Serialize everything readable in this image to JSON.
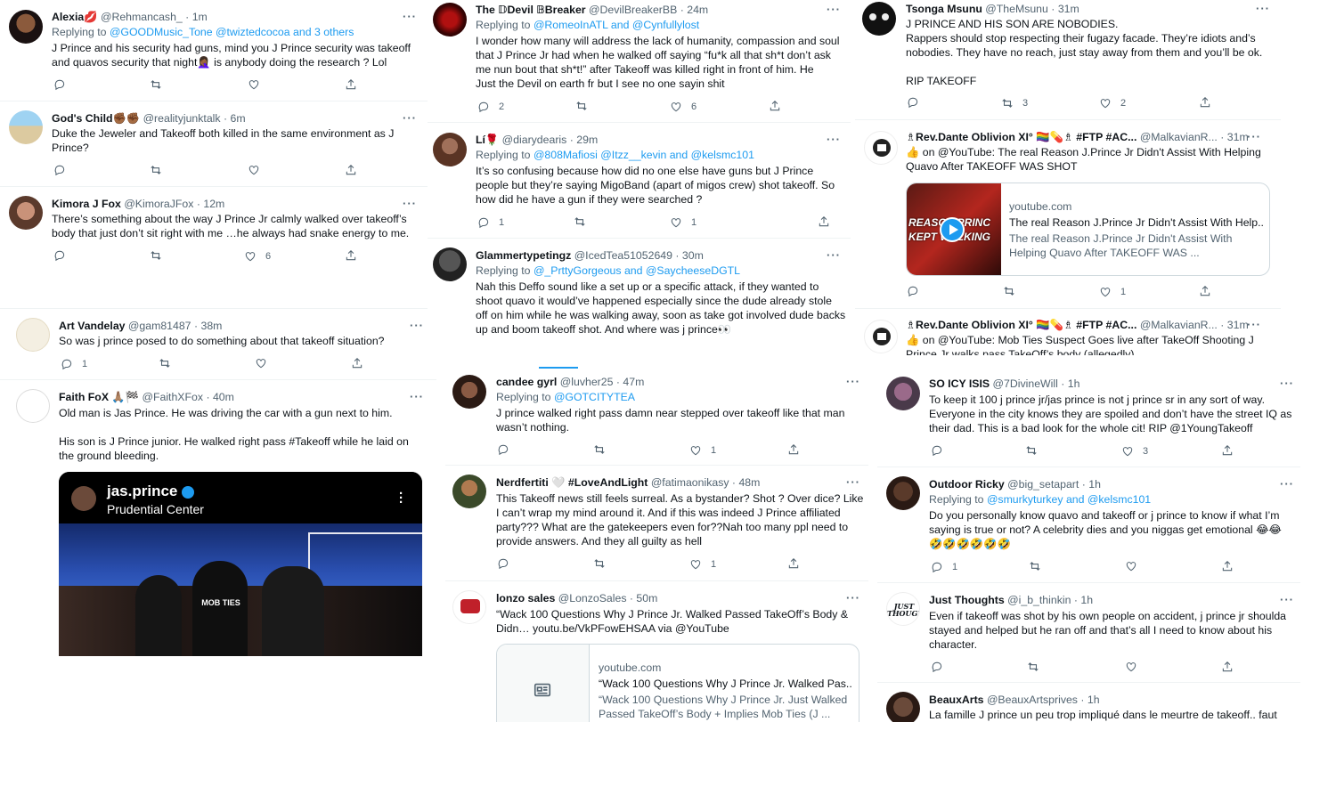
{
  "tweets": [
    {
      "name": "Alexia💋",
      "handle": "@Rehmancash_",
      "time": "1m",
      "reply_prefix": "Replying to ",
      "reply_to": "@GOODMusic_Tone @twiztedcocoa and 3 others",
      "text": "J Prince and his security had guns, mind you J Prince security was takeoff\nand quavos security that night🤦🏾‍♀️ is anybody doing the research ? Lol",
      "replies": "",
      "retweets": "",
      "likes": ""
    },
    {
      "name": "God's Child✊🏾✊🏾",
      "handle": "@realityjunktalk",
      "time": "6m",
      "reply_prefix": "",
      "reply_to": "",
      "text": "Duke the Jeweler and Takeoff both killed in the same environment as J\nPrince?",
      "replies": "",
      "retweets": "",
      "likes": ""
    },
    {
      "name": "Kimora J Fox",
      "handle": "@KimoraJFox",
      "time": "12m",
      "reply_prefix": "",
      "reply_to": "",
      "text": "There’s something about the way J Prince Jr calmly walked over takeoff’s\nbody that just don’t sit right with me …he always had snake energy to me.",
      "replies": "",
      "retweets": "",
      "likes": "6"
    },
    {
      "name": "Art Vandelay",
      "handle": "@gam81487",
      "time": "38m",
      "reply_prefix": "",
      "reply_to": "",
      "text": "So was j prince posed to do something about that takeoff situation?",
      "replies": "1",
      "retweets": "",
      "likes": ""
    },
    {
      "name": "Faith FoX 🙏🏽🏁",
      "handle": "@FaithXFox",
      "time": "40m",
      "reply_prefix": "",
      "reply_to": "",
      "text": "Old man is Jas Prince. He was driving the car with a gun next to him.\n\nHis son is J Prince junior. He walked right pass #Takeoff while he laid on\nthe ground bleeding.",
      "replies": "",
      "retweets": "",
      "likes": ""
    },
    {
      "name": "The 𝔻Devil 𝔹Breaker",
      "handle": "@DevilBreakerBB",
      "time": "24m",
      "reply_prefix": "Replying to ",
      "reply_to": "@RomeoInATL and @Cynfullylost",
      "text": "I wonder how many will address the lack of humanity, compassion and soul\nthat J Prince Jr had when he walked off saying “fu*k all that sh*t don’t ask\nme nun bout that sh*t!” after Takeoff was killed right in front of him. He\nJust the Devil on earth fr but I see no one sayin shit",
      "replies": "2",
      "retweets": "",
      "likes": "6"
    },
    {
      "name": "Lí🌹",
      "handle": "@diarydearis",
      "time": "29m",
      "reply_prefix": "Replying to ",
      "reply_to": "@808Mafiosi @Itzz__kevin and @kelsmc101",
      "text": "It’s so confusing because how did no one else have guns but J Prince\npeople but they’re saying MigoBand (apart of migos crew) shot takeoff. So\nhow did he have a gun if they were searched ?",
      "replies": "1",
      "retweets": "",
      "likes": "1"
    },
    {
      "name": "Glammertypetingz",
      "handle": "@IcedTea51052649",
      "time": "30m",
      "reply_prefix": "Replying to ",
      "reply_to": "@_PrttyGorgeous and @SaycheeseDGTL",
      "text": "Nah this Deffo sound like a set up or a specific attack, if they wanted to\nshoot quavo it would’ve happened especially since the dude already stole\noff on him while he was walking away, soon as take got involved dude backs\nup and boom takeoff shot. And where was j prince👀",
      "replies": "",
      "retweets": "",
      "likes": ""
    },
    {
      "name": "candee gyrl",
      "handle": "@luvher25",
      "time": "47m",
      "reply_prefix": "Replying to ",
      "reply_to": "@GOTCITYTEA",
      "text": "J prince walked right pass damn near stepped over takeoff like that man\nwasn’t nothing.",
      "replies": "",
      "retweets": "",
      "likes": "1"
    },
    {
      "name": "Nerdfertiti 🤍 #LoveAndLight",
      "handle": "@fatimaonikasy",
      "time": "48m",
      "reply_prefix": "",
      "reply_to": "",
      "text": "This Takeoff news still feels surreal. As a bystander? Shot ? Over dice? Like\nI can’t wrap my mind around it. And if this was indeed J Prince affiliated\nparty??? What are the gatekeepers even for??Nah too many ppl need to\nprovide answers. And they all guilty as hell",
      "replies": "",
      "retweets": "",
      "likes": "1"
    },
    {
      "name": "lonzo sales",
      "handle": "@LonzoSales",
      "time": "50m",
      "reply_prefix": "",
      "reply_to": "",
      "text": "“Wack 100 Questions Why J Prince Jr. Walked Passed TakeOff’s Body &\nDidn… youtu.be/VkPFowEHSAA via @YouTube",
      "replies": "",
      "retweets": "",
      "likes": ""
    },
    {
      "name": "Tsonga Msunu",
      "handle": "@TheMsunu",
      "time": "31m",
      "reply_prefix": "",
      "reply_to": "",
      "text": "J PRINCE AND HIS SON ARE NOBODIES.\nRappers should stop respecting their fugazy facade. They’re idiots and’s\nnobodies. They have no reach, just stay away from them and you’ll be ok.\n\nRIP TAKEOFF",
      "replies": "",
      "retweets": "3",
      "likes": "2"
    },
    {
      "name": "♗Rev.Dante Oblivion XI° 🏳️‍🌈💊♗ #FTP #AC...",
      "handle": "@MalkavianR...",
      "time": "31m",
      "reply_prefix": "",
      "reply_to": "",
      "text": "👍 on @YouTube: The real Reason J.Prince Jr Didn't Assist With Helping\nQuavo After TAKEOFF WAS SHOT",
      "replies": "",
      "retweets": "",
      "likes": "1"
    },
    {
      "name": "♗Rev.Dante Oblivion XI° 🏳️‍🌈💊♗ #FTP #AC...",
      "handle": "@MalkavianR...",
      "time": "31m",
      "reply_prefix": "",
      "reply_to": "",
      "text": "👍 on @YouTube: Mob Ties Suspect Goes live after TakeOff Shooting J\nPrince Jr walks pass TakeOff’s body (allegedly)",
      "replies": "",
      "retweets": "",
      "likes": ""
    },
    {
      "name": "SO ICY ISIS",
      "handle": "@7DivineWill",
      "time": "1h",
      "reply_prefix": "",
      "reply_to": "",
      "text": "To keep it 100 j prince jr/jas prince is not j prince sr in any sort of way.\nEveryone in the city knows they are spoiled and don’t have the street IQ as\ntheir dad. This is a bad look for the whole cit! RIP @1YoungTakeoff",
      "replies": "",
      "retweets": "",
      "likes": "3"
    },
    {
      "name": "Outdoor Ricky",
      "handle": "@big_setapart",
      "time": "1h",
      "reply_prefix": "Replying to ",
      "reply_to": "@smurkyturkey and @kelsmc101",
      "text": "Do you personally know quavo and takeoff or j prince to know if what I’m\nsaying is true or not? A celebrity dies and you niggas get emotional 😂😂\n🤣🤣🤣🤣🤣🤣",
      "replies": "1",
      "retweets": "",
      "likes": ""
    },
    {
      "name": "Just Thoughts",
      "handle": "@i_b_thinkin",
      "time": "1h",
      "reply_prefix": "",
      "reply_to": "",
      "text": "Even if takeoff was shot by his own people on accident, j prince jr shoulda\nstayed and helped but he ran off and that’s all I need to know about his\ncharacter.",
      "replies": "",
      "retweets": "",
      "likes": ""
    },
    {
      "name": "BeauxArts",
      "handle": "@BeauxArtsprives",
      "time": "1h",
      "reply_prefix": "",
      "reply_to": "",
      "text": "La famille J prince un peu trop impliqué dans le meurtre de takeoff.. faut",
      "replies": "",
      "retweets": "",
      "likes": ""
    }
  ],
  "embed_image": {
    "account": "jas.prince",
    "location": "Prudential Center",
    "jersey": "MOB TIES"
  },
  "card1": {
    "domain": "youtube.com",
    "title": "The real Reason J.Prince Jr Didn't Assist With Help...",
    "desc": "The real Reason J.Prince Jr Didn't Assist With\nHelping Quavo After TAKEOFF WAS ...",
    "thumb_text": "REASON PRINC\nKEPT WALKING"
  },
  "card2": {
    "domain": "youtube.com",
    "title": "“Wack 100 Questions Why J Prince Jr. Walked Pas...",
    "desc": "“Wack 100 Questions Why J Prince Jr. Just Walked\nPassed TakeOff’s Body + Implies Mob Ties (J ..."
  },
  "icons": {
    "reply": "reply-icon",
    "retweet": "retweet-icon",
    "like": "heart-icon",
    "share": "share-icon",
    "more": "more-icon",
    "verified": "verified-badge-icon",
    "article": "article-icon",
    "play": "play-icon"
  }
}
